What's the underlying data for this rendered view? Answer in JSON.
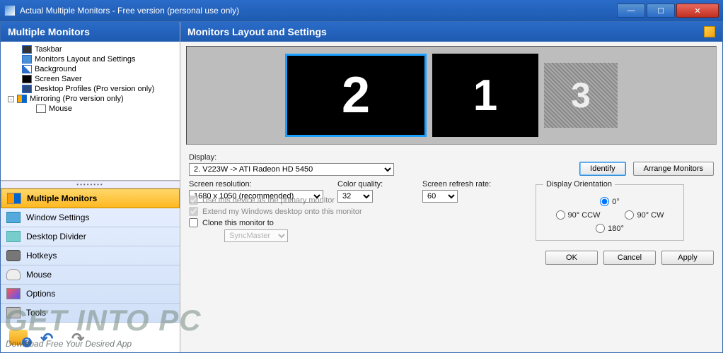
{
  "window": {
    "title": "Actual Multiple Monitors - Free version (personal use only)"
  },
  "left": {
    "header": "Multiple Monitors",
    "tree": {
      "taskbar": "Taskbar",
      "layout": "Monitors Layout and Settings",
      "background": "Background",
      "saver": "Screen Saver",
      "profiles": "Desktop Profiles (Pro version only)",
      "mirroring": "Mirroring (Pro version only)",
      "mouse": "Mouse"
    },
    "categories": {
      "monitors": "Multiple Monitors",
      "window": "Window Settings",
      "divider": "Desktop Divider",
      "hotkeys": "Hotkeys",
      "mouse": "Mouse",
      "options": "Options",
      "tools": "Tools"
    }
  },
  "right": {
    "header": "Monitors Layout and Settings",
    "monitors": {
      "m1": "1",
      "m2": "2",
      "m3": "3"
    },
    "labels": {
      "display": "Display:",
      "resolution": "Screen resolution:",
      "color": "Color quality:",
      "refresh": "Screen refresh rate:",
      "orientation": "Display Orientation",
      "primary": "Use this device as the primary monitor",
      "extend": "Extend my Windows desktop onto this monitor",
      "clone": "Clone this monitor to"
    },
    "values": {
      "display": "2. V223W -> ATI Radeon HD 5450",
      "resolution": "1680 x 1050 (recommended)",
      "color": "32",
      "refresh": "60",
      "clone_target": "SyncMaster"
    },
    "orientation": {
      "o0": "0°",
      "o90ccw": "90° CCW",
      "o90cw": "90° CW",
      "o180": "180°"
    },
    "buttons": {
      "identify": "Identify",
      "arrange": "Arrange Monitors",
      "ok": "OK",
      "cancel": "Cancel",
      "apply": "Apply"
    }
  },
  "watermark": {
    "main": "GET INTO PC",
    "sub": "Download Free Your Desired App"
  }
}
